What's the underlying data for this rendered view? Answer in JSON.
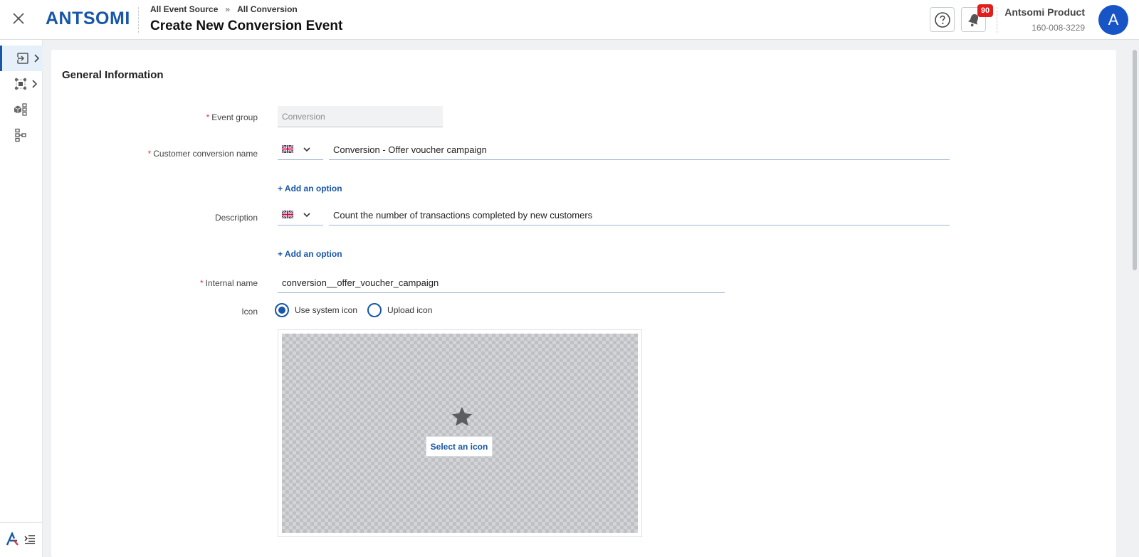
{
  "header": {
    "logo_text": "ANTSOMI",
    "breadcrumb": [
      "All Event Source",
      "All Conversion"
    ],
    "breadcrumb_separator": "»",
    "title": "Create New Conversion Event",
    "notification_count": "90",
    "account_name": "Antsomi Product",
    "account_id": "160-008-3229",
    "avatar_letter": "A"
  },
  "form": {
    "section_title": "General Information",
    "event_group": {
      "label": "Event group",
      "value": "Conversion"
    },
    "customer_conversion_name": {
      "label": "Customer conversion name",
      "value": "Conversion - Offer voucher campaign"
    },
    "description": {
      "label": "Description",
      "value": "Count the number of transactions completed by new customers"
    },
    "add_option_label": "+ Add an option",
    "internal_name": {
      "label": "Internal name",
      "value": "conversion__offer_voucher_campaign"
    },
    "icon": {
      "label": "Icon",
      "options": [
        "Use system icon",
        "Upload icon"
      ],
      "selected": "Use system icon",
      "select_button": "Select an icon"
    },
    "required_mark": "*"
  },
  "colors": {
    "accent": "#1856a8",
    "required": "#e53935",
    "badge": "#e01e1e",
    "avatar": "#1755c6"
  }
}
